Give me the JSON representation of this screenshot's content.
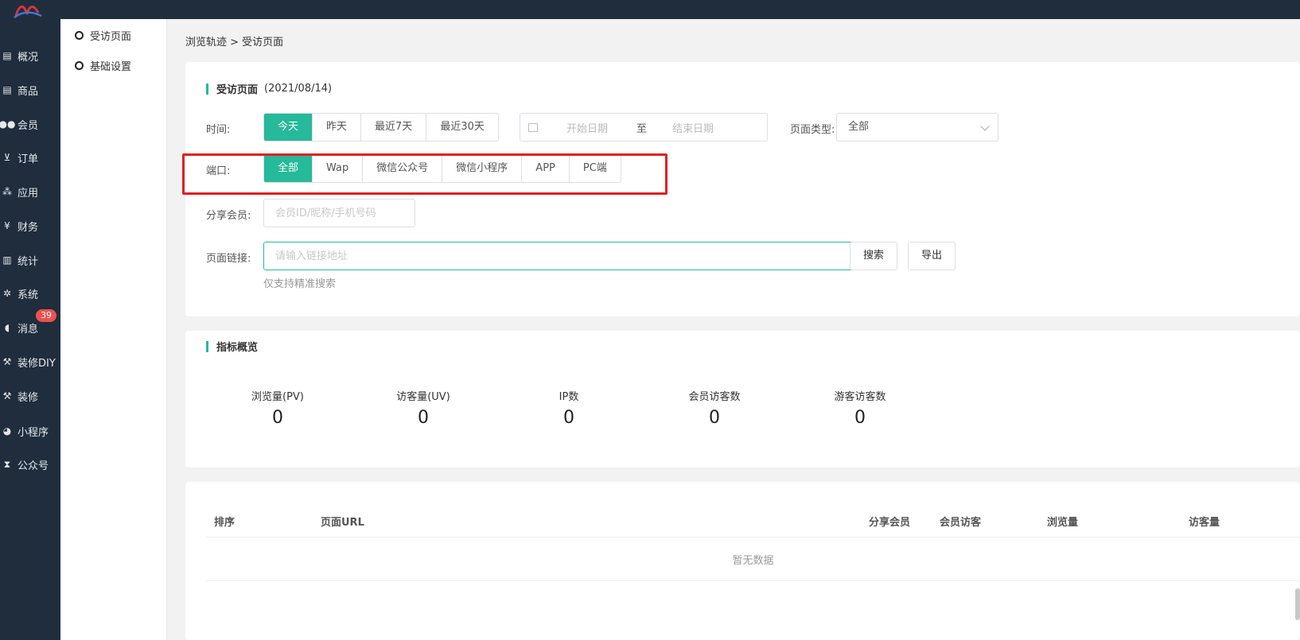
{
  "topnav": {
    "logo_icon": "brand-logo"
  },
  "sidebar": {
    "items": [
      {
        "label": "概况",
        "icon": "archive-icon"
      },
      {
        "label": "商品",
        "icon": "archive-icon"
      },
      {
        "label": "会员",
        "icon": "users-icon"
      },
      {
        "label": "订单",
        "icon": "cart-icon"
      },
      {
        "label": "应用",
        "icon": "cubes-icon"
      },
      {
        "label": "财务",
        "icon": "yen-icon"
      },
      {
        "label": "统计",
        "icon": "bar-chart-icon"
      },
      {
        "label": "系统",
        "icon": "gears-icon"
      },
      {
        "label": "消息",
        "icon": "comment-icon",
        "badge": "39"
      },
      {
        "label": "装修DIY",
        "icon": "gavel-icon"
      },
      {
        "label": "装修",
        "icon": "gavel-icon"
      },
      {
        "label": "小程序",
        "icon": "wechat-icon"
      },
      {
        "label": "公众号",
        "icon": "hourglass-icon"
      }
    ]
  },
  "subnav": {
    "items": [
      {
        "label": "受访页面"
      },
      {
        "label": "基础设置"
      }
    ]
  },
  "breadcrumb": "浏览轨迹 > 受访页面",
  "filter": {
    "title": "受访页面",
    "date": "(2021/08/14)",
    "time_label": "时间:",
    "time_options": [
      "今天",
      "昨天",
      "最近7天",
      "最近30天"
    ],
    "time_selected": "今天",
    "date_start_placeholder": "开始日期",
    "date_to": "至",
    "date_end_placeholder": "结束日期",
    "page_type_label": "页面类型:",
    "page_type_value": "全部",
    "port_label": "端口:",
    "port_options": [
      "全部",
      "Wap",
      "微信公众号",
      "微信小程序",
      "APP",
      "PC端"
    ],
    "port_selected": "全部",
    "share_label": "分享会员:",
    "share_placeholder": "会员ID/昵称/手机号码",
    "link_label": "页面链接:",
    "link_placeholder": "请输入链接地址",
    "search_button": "搜索",
    "export_button": "导出",
    "hint": "仅支持精准搜索"
  },
  "metrics": {
    "title": "指标概览",
    "items": [
      {
        "label": "浏览量(PV)",
        "value": "0"
      },
      {
        "label": "访客量(UV)",
        "value": "0"
      },
      {
        "label": "IP数",
        "value": "0"
      },
      {
        "label": "会员访客数",
        "value": "0"
      },
      {
        "label": "游客访客数",
        "value": "0"
      }
    ]
  },
  "table": {
    "columns": [
      "排序",
      "页面URL",
      "分享会员",
      "会员访客",
      "浏览量",
      "访客量"
    ],
    "empty_text": "暂无数据"
  },
  "colors": {
    "accent": "#26b99a",
    "sidebar_bg": "#1f2d3d",
    "highlight": "#e02020",
    "badge": "#f05050"
  }
}
